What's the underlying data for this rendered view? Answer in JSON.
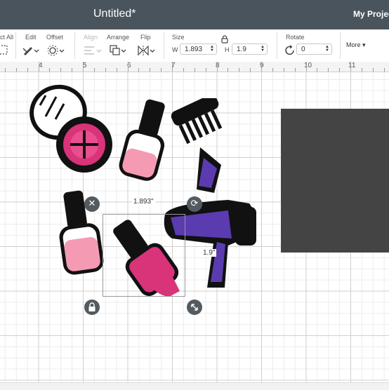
{
  "header": {
    "doc_title": "Untitled*",
    "project_button": "My Projects"
  },
  "toolbar": {
    "select_all": "ct All",
    "edit": "Edit",
    "offset": "Offset",
    "align": "Align",
    "arrange": "Arrange",
    "flip": "Flip",
    "size": "Size",
    "width_prefix": "W",
    "width_value": "1.893",
    "height_prefix": "H",
    "height_value": "1.9",
    "rotate": "Rotate",
    "rotate_value": "0",
    "more": "More"
  },
  "ruler": {
    "numbers": [
      "4",
      "5",
      "6",
      "7",
      "8",
      "9",
      "10",
      "11"
    ]
  },
  "selection": {
    "width_label": "1.893\"",
    "height_label": "1.9\""
  },
  "colors": {
    "topbar": "#4a545c",
    "pink": "#e0407e",
    "light_pink": "#f39ab4",
    "purple": "#5b3bb0",
    "rect": "#444444"
  },
  "icons": [
    "lock-icon",
    "close-icon",
    "rotate-icon",
    "resize-icon",
    "chevron-down-icon"
  ]
}
